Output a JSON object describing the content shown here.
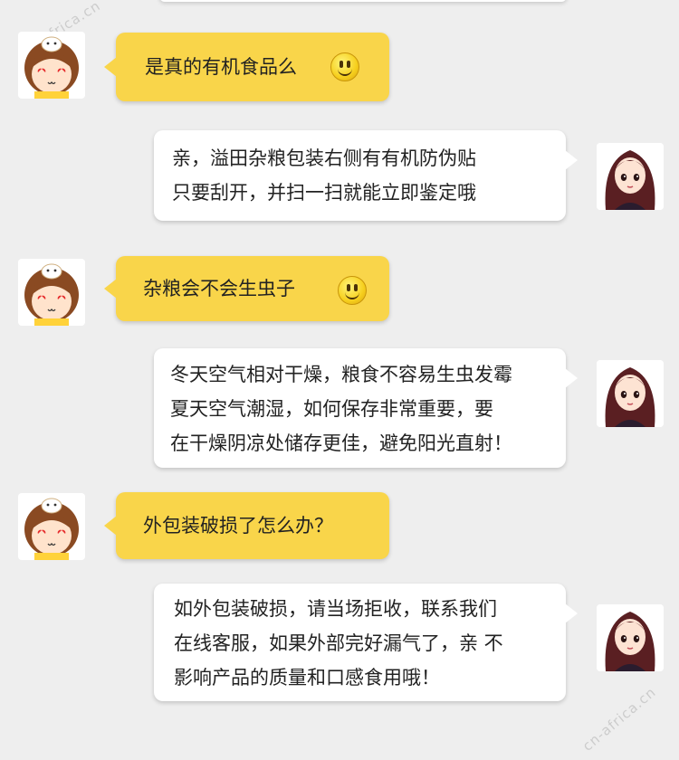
{
  "colors": {
    "background": "#eeeeee",
    "customer_bubble": "#f9d54a",
    "agent_bubble": "#ffffff",
    "text": "#222222"
  },
  "watermark": "cn-africa.cn",
  "messages": [
    {
      "sender": "customer",
      "lines": [
        "是真的有机食品么"
      ],
      "emoji": "smiley-icon"
    },
    {
      "sender": "agent",
      "lines": [
        "亲，溢田杂粮包装右侧有有机防伪贴",
        "只要刮开，并扫一扫就能立即鉴定哦"
      ]
    },
    {
      "sender": "customer",
      "lines": [
        "杂粮会不会生虫子"
      ],
      "emoji": "smiley-icon"
    },
    {
      "sender": "agent",
      "lines": [
        "冬天空气相对干燥，粮食不容易生虫发霉",
        "夏天空气潮湿，如何保存非常重要，要",
        "在干燥阴凉处储存更佳，避免阳光直射！"
      ]
    },
    {
      "sender": "customer",
      "lines": [
        "外包装破损了怎么办？"
      ]
    },
    {
      "sender": "agent",
      "lines": [
        "如外包装破损，请当场拒收，联系我们",
        "在线客服，如果外部完好漏气了，亲 不",
        "影响产品的质量和口感食用哦！"
      ]
    }
  ]
}
